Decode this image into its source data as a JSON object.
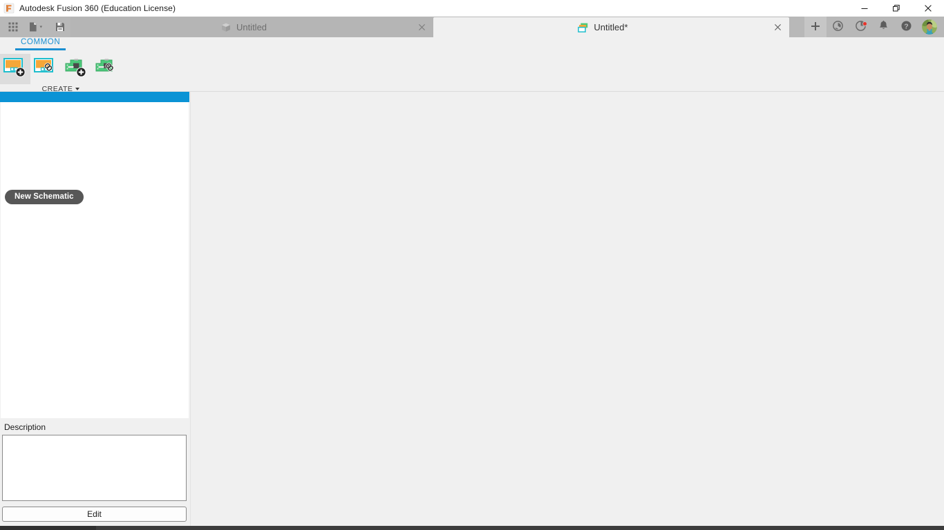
{
  "window": {
    "title": "Autodesk Fusion 360 (Education License)",
    "logo_icon": "fusion-360-logo-icon",
    "controls": {
      "minimize": "minimize-icon",
      "maximize": "restore-icon",
      "close": "close-icon"
    }
  },
  "quick_access": {
    "items": [
      {
        "name": "app-grid-button",
        "icon": "grid-apps-icon"
      },
      {
        "name": "new-file-button",
        "icon": "file-new-icon"
      },
      {
        "name": "save-button",
        "icon": "save-floppy-icon"
      }
    ]
  },
  "document_tabs": [
    {
      "label": "Untitled",
      "icon": "cube-3d-model-icon",
      "active": false,
      "close_icon": "close-icon"
    },
    {
      "label": "Untitled*",
      "icon": "electronics-schematic-icon",
      "active": true,
      "close_icon": "close-icon"
    }
  ],
  "tab_right_buttons": [
    {
      "name": "new-design-button",
      "icon": "plus-icon",
      "badge": false
    },
    {
      "name": "job-status-button",
      "icon": "job-status-clock-icon",
      "badge": false
    },
    {
      "name": "notifications-progress-button",
      "icon": "pie-progress-icon",
      "badge": true
    },
    {
      "name": "alerts-button",
      "icon": "bell-icon",
      "badge": false
    },
    {
      "name": "help-button",
      "icon": "help-question-icon",
      "badge": false
    }
  ],
  "account": {
    "name": "user-avatar",
    "icon": "avatar-photo-icon"
  },
  "ribbon": {
    "tabs": [
      {
        "label": "COMMON",
        "active": true
      }
    ],
    "panel": {
      "label": "CREATE",
      "caret_icon": "chevron-down-icon",
      "buttons": [
        {
          "name": "new-schematic-button",
          "icon": "schematic-sheet-plus-icon",
          "hovered": true
        },
        {
          "name": "add-schematic-link-button",
          "icon": "schematic-sheet-link-icon",
          "hovered": false
        },
        {
          "name": "new-pcb-button",
          "icon": "pcb-board-plus-icon",
          "hovered": false
        },
        {
          "name": "add-pcb-link-button",
          "icon": "pcb-board-link-icon",
          "hovered": false
        }
      ]
    }
  },
  "sidebar": {
    "list_items": [],
    "description_label": "Description",
    "description_value": "",
    "description_placeholder": "",
    "edit_button_label": "Edit"
  },
  "tooltip": {
    "visible": true,
    "text": "New Schematic"
  },
  "colors": {
    "accent_blue": "#0b93d5",
    "ribbon_tab_blue": "#1a8fd1",
    "tabbar_gray": "#b8b8b8",
    "canvas_gray": "#f0f0f0",
    "tooltip_gray": "#575757",
    "badge_red": "#e8332a",
    "schematic_orange": "#f5a739",
    "schematic_cyan": "#1fbecd",
    "pcb_green": "#4cc97a"
  }
}
